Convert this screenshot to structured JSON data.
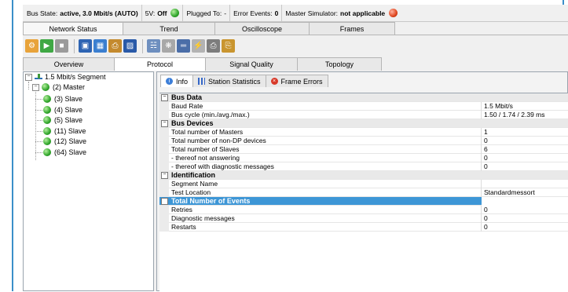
{
  "status_bar": {
    "bus_state_label": "Bus State:",
    "bus_state_value": "active, 3.0 Mbit/s (AUTO)",
    "sv_label": "5V:",
    "sv_value": "Off",
    "plugged_label": "Plugged To:",
    "plugged_value": "-",
    "error_events_label": "Error Events:",
    "error_events_value": "0",
    "master_sim_label": "Master Simulator:",
    "master_sim_value": "not applicable"
  },
  "main_tabs": [
    {
      "label": "Network Status"
    },
    {
      "label": "Trend"
    },
    {
      "label": "Oscilloscope"
    },
    {
      "label": "Frames"
    }
  ],
  "toolbar_icons": [
    "connect-icon",
    "play-icon",
    "stop-icon",
    "save-icon",
    "open-icon",
    "print-icon",
    "screenshot-icon",
    "topology-icon",
    "network-scan-icon",
    "bus-icon",
    "plug-icon",
    "printer-icon",
    "copy-icon"
  ],
  "sub_tabs": [
    {
      "label": "Overview"
    },
    {
      "label": "Protocol"
    },
    {
      "label": "Signal Quality"
    },
    {
      "label": "Topology"
    }
  ],
  "tree": {
    "segment": "1.5 Mbit/s Segment",
    "master": "(2) Master",
    "slaves": [
      "(3) Slave",
      "(4) Slave",
      "(5) Slave",
      "(11) Slave",
      "(12) Slave",
      "(64) Slave"
    ]
  },
  "panel_tabs": [
    {
      "label": "Info",
      "icon": "info-icon"
    },
    {
      "label": "Station Statistics",
      "icon": "bar-chart-icon"
    },
    {
      "label": "Frame Errors",
      "icon": "error-icon"
    }
  ],
  "grid": {
    "bus_data": {
      "title": "Bus Data",
      "baud_rate": {
        "label": "Baud Rate",
        "value": "1.5 Mbit/s"
      },
      "bus_cycle": {
        "label": "Bus cycle (min./avg./max.)",
        "value": "1.50 / 1.74 / 2.39 ms"
      }
    },
    "bus_devices": {
      "title": "Bus Devices",
      "masters": {
        "label": "Total number of Masters",
        "value": "1"
      },
      "non_dp": {
        "label": "Total number of non-DP devices",
        "value": "0"
      },
      "slaves": {
        "label": "Total number of Slaves",
        "value": "6"
      },
      "not_answering": {
        "label": "- thereof not answering",
        "value": "0"
      },
      "with_diag": {
        "label": "- thereof with diagnostic messages",
        "value": "0"
      }
    },
    "identification": {
      "title": "Identification",
      "segment_name": {
        "label": "Segment Name",
        "value": ""
      },
      "test_location": {
        "label": "Test Location",
        "value": "Standardmessort"
      }
    },
    "events": {
      "title": "Total Number of Events",
      "retries": {
        "label": "Retries",
        "value": "0"
      },
      "diag": {
        "label": "Diagnostic messages",
        "value": "0"
      },
      "restarts": {
        "label": "Restarts",
        "value": "0"
      }
    }
  }
}
